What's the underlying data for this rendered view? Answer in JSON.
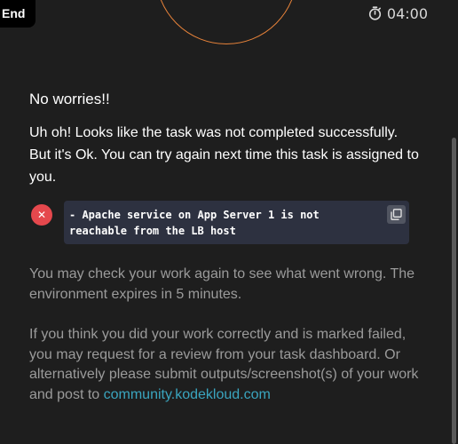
{
  "topbar": {
    "end_label": "End",
    "timer": "04:00",
    "timer_icon": "stopwatch-icon"
  },
  "result": {
    "heading": "No worries!!",
    "message": "Uh oh! Looks like the task was not completed successfully. But it's Ok. You can try again next time this task is assigned to you."
  },
  "error": {
    "icon": "close-icon",
    "text": "- Apache service on App Server 1 is not reachable from the LB host",
    "copy_icon": "copy-icon"
  },
  "info": {
    "check_text": "You may check your work again to see what went wrong. The environment expires in 5 minutes.",
    "review_text": "If you think you did your work correctly and is marked failed, you may request for a review from your task dashboard. Or alternatively please submit outputs/screenshot(s) of your work and post to",
    "link_text": "community.kodekloud.com"
  },
  "colors": {
    "accent_orange": "#e8833a",
    "error_red": "#e5484d",
    "link": "#3aa5bf"
  }
}
